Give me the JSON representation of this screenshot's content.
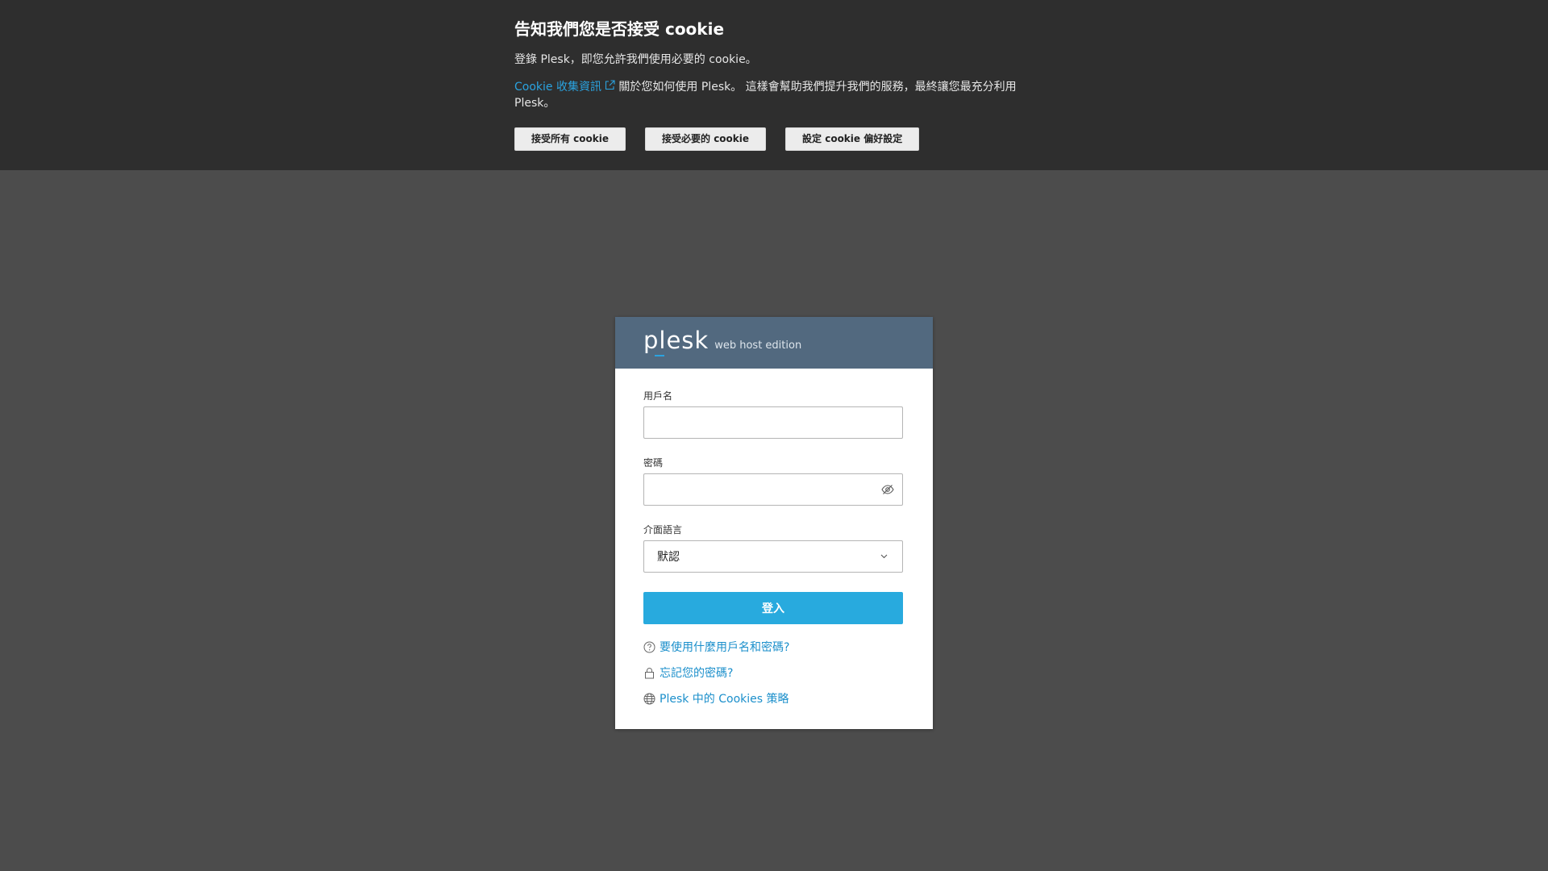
{
  "cookie_banner": {
    "title": "告知我們您是否接受 cookie",
    "line1": "登錄 Plesk，即您允許我們使用必要的 cookie。",
    "link_text": "Cookie 收集資訊",
    "line2_rest": " 關於您如何使用 Plesk。 這樣會幫助我們提升我們的服務，最終讓您最充分利用 Plesk。",
    "buttons": {
      "accept_all": "接受所有 cookie",
      "accept_necessary": "接受必要的 cookie",
      "preferences": "設定 cookie 偏好設定"
    }
  },
  "login": {
    "logo_word": "plesk",
    "edition": "web host edition",
    "username_label": "用戶名",
    "username_value": "",
    "password_label": "密碼",
    "password_value": "",
    "language_label": "介面語言",
    "language_value": "默認",
    "login_button": "登入",
    "help_links": {
      "credentials": "要使用什麼用戶名和密碼?",
      "forgot": "忘記您的密碼?",
      "cookies_policy": "Plesk 中的 Cookies 策略"
    }
  },
  "colors": {
    "banner_bg": "#2e2e2e",
    "page_bg": "#4c4c4c",
    "header_bg": "#52697f",
    "accent": "#28aade",
    "link": "#1b8fcb"
  },
  "icons": {
    "external_link": "external-link-icon",
    "password_toggle": "eye-slash-icon",
    "select_chevron": "chevron-down-icon",
    "help": "question-circle-icon",
    "lock": "lock-icon",
    "globe": "globe-icon"
  }
}
